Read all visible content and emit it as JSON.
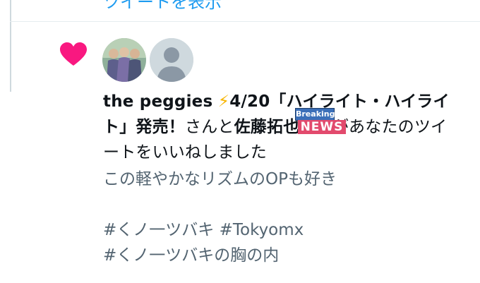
{
  "top_link": "ツイートを表示",
  "notification": {
    "user_name": "the peggies",
    "bolt_icon": "⚡",
    "name_rest": "4/20「ハイライト・ハイライト」発売！",
    "middle_text": "さんと",
    "other_user": "佐藤拓也",
    "suffix": "さんがあなたのツイートをいいねしました"
  },
  "overlay": {
    "top": "Breaking",
    "bottom": "NEWS"
  },
  "tweet": {
    "line1": "この軽やかなリズムのOPも好き",
    "line3": "#くノ一ツバキ #Tokyomx",
    "line4": "#くノ一ツバキの胸の内"
  },
  "colors": {
    "heart": "#f91880",
    "link": "#1d9bf0",
    "muted": "#536471",
    "text": "#0f1419"
  }
}
